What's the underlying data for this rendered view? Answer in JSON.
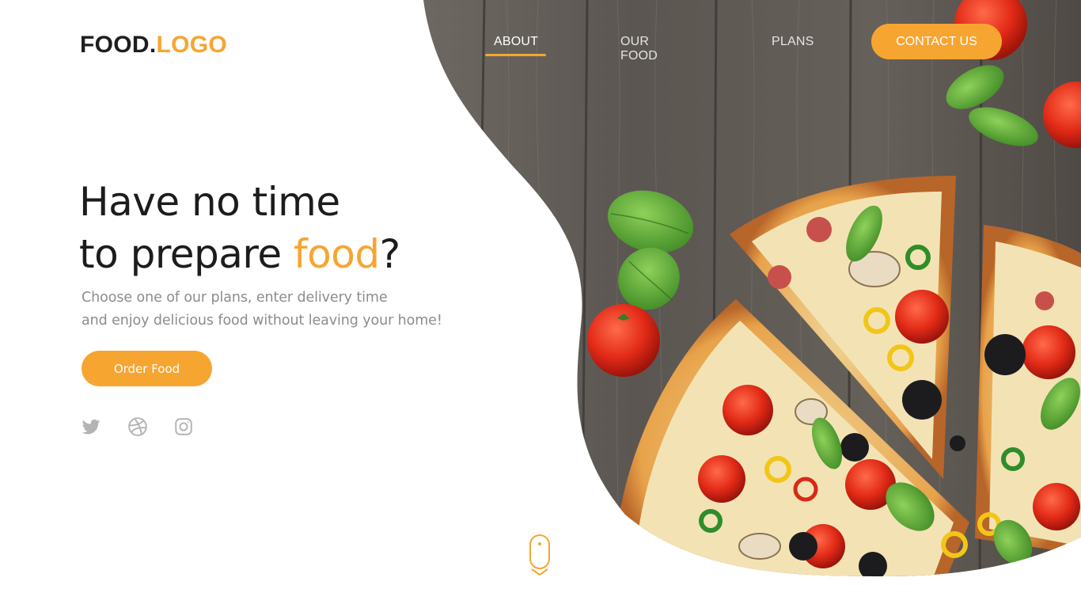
{
  "brand": {
    "logo_main": "FOOD.",
    "logo_accent": "LOGO"
  },
  "nav": {
    "items": [
      {
        "label": "ABOUT",
        "active": true
      },
      {
        "label": "OUR FOOD",
        "active": false
      },
      {
        "label": "PLANS",
        "active": false
      }
    ],
    "contact_label": "CONTACT US"
  },
  "hero": {
    "headline_line1": "Have no time",
    "headline_line2_pre": "to prepare ",
    "headline_line2_accent": "food",
    "headline_line2_post": "?",
    "subtext_line1": "Choose one of our plans, enter delivery time",
    "subtext_line2": "and enjoy delicious food without leaving your home!",
    "cta_label": "Order Food"
  },
  "social": [
    {
      "icon": "twitter-icon"
    },
    {
      "icon": "dribbble-icon"
    },
    {
      "icon": "instagram-icon"
    }
  ],
  "colors": {
    "accent": "#f7a531",
    "text_dark": "#1c1c1c",
    "text_muted": "#8c8c8c",
    "icon_grey": "#b4b4b4",
    "wood": "#5e5a55"
  }
}
